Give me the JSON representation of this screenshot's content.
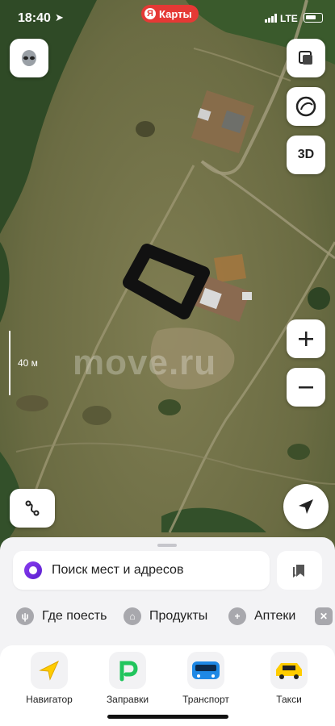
{
  "status_bar": {
    "time": "18:40",
    "network": "LTE"
  },
  "brand": {
    "label": "Карты"
  },
  "map": {
    "scale_label": "40 м",
    "watermark": "move.ru",
    "view_3d_label": "3D"
  },
  "search": {
    "placeholder": "Поиск мест и адресов"
  },
  "categories": [
    {
      "label": "Где поесть",
      "icon": "fork-knife-icon"
    },
    {
      "label": "Продукты",
      "icon": "basket-icon"
    },
    {
      "label": "Аптеки",
      "icon": "pharmacy-cross-icon"
    }
  ],
  "dock": [
    {
      "label": "Навигатор",
      "icon": "navigator-arrow-icon",
      "color": "#ffcc00"
    },
    {
      "label": "Заправки",
      "icon": "fuel-p-icon",
      "color": "#21c55d"
    },
    {
      "label": "Транспорт",
      "icon": "bus-icon",
      "color": "#1e88e5"
    },
    {
      "label": "Такси",
      "icon": "taxi-car-icon",
      "color": "#ffcc00"
    }
  ],
  "colors": {
    "brand_red": "#e53935",
    "alice_purple": "#7b2ff0"
  }
}
